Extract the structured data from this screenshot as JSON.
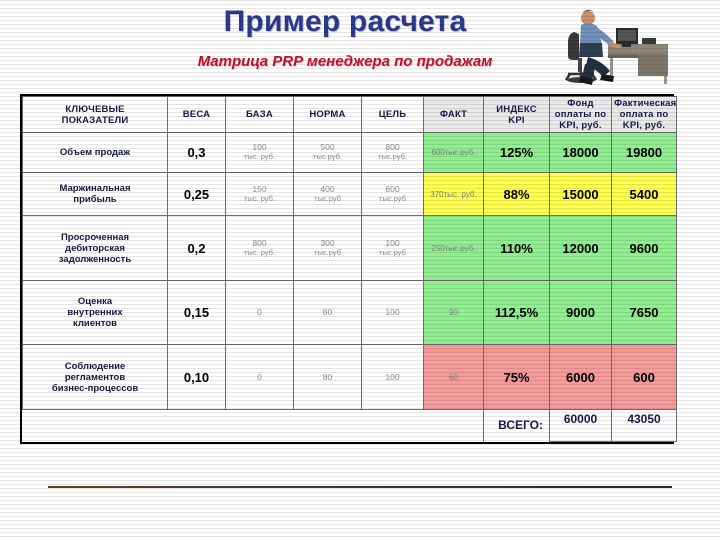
{
  "slide": {
    "title": "Пример расчета",
    "subtitle": "Матрица PRP менеджера по продажам",
    "photo_alt": "businessman-at-desk-photo"
  },
  "colors": {
    "title": "#2b3a8f",
    "subtitle": "#c8102e",
    "green": "#90ee90",
    "yellow": "#ffff4d",
    "red": "#f59a9a",
    "header_shade": "#e9e9e9"
  },
  "table": {
    "headers": [
      "КЛЮЧЕВЫЕ ПОКАЗАТЕЛИ",
      "ВЕСА",
      "БАЗА",
      "НОРМА",
      "ЦЕЛЬ",
      "ФАКТ",
      "ИНДЕКС KPI",
      "Фонд оплаты по KPI, руб.",
      "Фактическая оплата по KPI, руб."
    ],
    "headers_lines": [
      [
        "КЛЮЧЕВЫЕ",
        "ПОКАЗАТЕЛИ"
      ],
      [
        "ВЕСА"
      ],
      [
        "БАЗА"
      ],
      [
        "НОРМА"
      ],
      [
        "ЦЕЛЬ"
      ],
      [
        "ФАКТ"
      ],
      [
        "ИНДЕКС",
        "KPI"
      ],
      [
        "Фонд",
        "оплаты по",
        "KPI, руб."
      ],
      [
        "Фактическая",
        "оплата по",
        "KPI, руб."
      ]
    ],
    "rows": [
      {
        "kpi_lines": [
          "Объем продаж"
        ],
        "weight": "0,3",
        "base": "100",
        "base_unit": "тыс. руб.",
        "norm": "500",
        "norm_unit": "тыс.руб.",
        "goal": "800",
        "goal_unit": "тыс.руб.",
        "fact": "600",
        "fact_unit": "тыс.руб.",
        "index": "125%",
        "fund": "18000",
        "actual": "19800",
        "status": "green"
      },
      {
        "kpi_lines": [
          "Маржинальная",
          "прибыль"
        ],
        "weight": "0,25",
        "base": "150",
        "base_unit": "тыс. руб.",
        "norm": "400",
        "norm_unit": "тыс.руб",
        "goal": "600",
        "goal_unit": "тыс.руб",
        "fact": "370",
        "fact_unit": "тыс. руб.",
        "index": "88%",
        "fund": "15000",
        "actual": "5400",
        "status": "yellow"
      },
      {
        "kpi_lines": [
          "Просроченная",
          "дебиторская",
          "задолженность"
        ],
        "weight": "0,2",
        "base": "800",
        "base_unit": "тыс. руб.",
        "norm": "300",
        "norm_unit": "тыс.руб",
        "goal": "100",
        "goal_unit": "тыс.руб",
        "fact": "250",
        "fact_unit": "тыс.руб.",
        "index": "110%",
        "fund": "12000",
        "actual": "9600",
        "status": "green"
      },
      {
        "kpi_lines": [
          "Оценка",
          "внутренних",
          "клиентов"
        ],
        "weight": "0,15",
        "base": "0",
        "base_unit": "",
        "norm": "80",
        "norm_unit": "",
        "goal": "100",
        "goal_unit": "",
        "fact": "90",
        "fact_unit": "",
        "index": "112,5%",
        "fund": "9000",
        "actual": "7650",
        "status": "green"
      },
      {
        "kpi_lines": [
          "Соблюдение",
          "регламентов",
          "бизнес-процессов"
        ],
        "weight": "0,10",
        "base": "0",
        "base_unit": "",
        "norm": "80",
        "norm_unit": "",
        "goal": "100",
        "goal_unit": "",
        "fact": "60",
        "fact_unit": "",
        "index": "75%",
        "fund": "6000",
        "actual": "600",
        "status": "red"
      }
    ],
    "total": {
      "label": "ВСЕГО:",
      "fund": "60000",
      "actual": "43050"
    }
  }
}
